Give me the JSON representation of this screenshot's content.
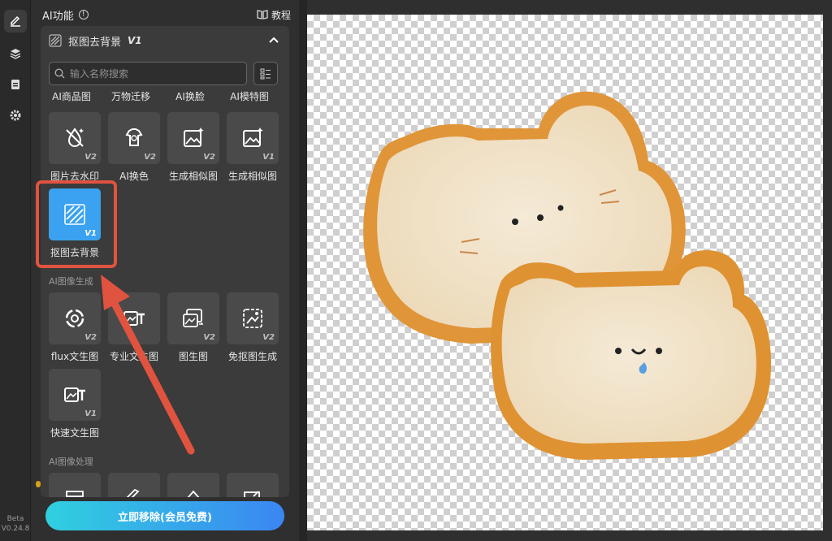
{
  "sidebar_rail": {
    "version_line1": "Beta",
    "version_line2": "V0.24.8"
  },
  "panel": {
    "title": "AI功能",
    "tutorial_label": "教程",
    "card_title": "抠图去背景",
    "card_title_version": "V1",
    "search_placeholder": "输入名称搜索",
    "top_row_labels": [
      "AI商品图",
      "万物迁移",
      "AI换脸",
      "AI模特图"
    ],
    "tools_row1": [
      {
        "label": "图片去水印",
        "ver": "V2",
        "icon": "watermark-off-icon"
      },
      {
        "label": "AI换色",
        "ver": "V2",
        "icon": "color-palette-icon"
      },
      {
        "label": "生成相似图",
        "ver": "V2",
        "icon": "image-sparkle-icon"
      },
      {
        "label": "生成相似图",
        "ver": "V1",
        "icon": "image-sparkle-icon"
      }
    ],
    "selected_tool": {
      "label": "抠图去背景",
      "ver": "V1",
      "icon": "bg-remove-icon"
    },
    "section_gen": "AI图像生成",
    "tools_gen": [
      {
        "label": "flux文生图",
        "ver": "V2",
        "icon": "flux-swirl-icon"
      },
      {
        "label": "专业文生图",
        "ver": "",
        "icon": "text-to-image-icon"
      },
      {
        "label": "图生图",
        "ver": "V2",
        "icon": "image-to-image-icon"
      },
      {
        "label": "免抠图生成",
        "ver": "V2",
        "icon": "cutout-free-icon"
      }
    ],
    "tool_fast": {
      "label": "快速文生图",
      "ver": "V1",
      "icon": "text-to-image-icon"
    },
    "section_process": "AI图像处理",
    "cta_label": "立即移除(会员免费)"
  },
  "colors": {
    "accent": "#3aa2f0",
    "highlight": "#e0533f",
    "cta_start": "#30d0e0",
    "cta_end": "#3b86f2"
  }
}
